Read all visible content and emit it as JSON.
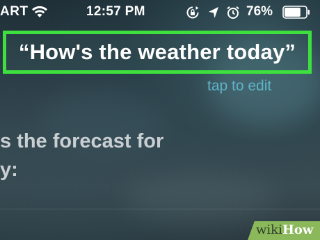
{
  "status_bar": {
    "carrier": "ART",
    "time": "12:57 PM",
    "battery_percent": "76%",
    "battery_level": 0.76,
    "icons": [
      "wifi-icon",
      "rotation-lock-icon",
      "location-icon",
      "alarm-icon",
      "battery-icon"
    ]
  },
  "siri": {
    "query": "“How's the weather today”",
    "tap_to_edit": "tap to edit",
    "response_line_1": "s the forecast for",
    "response_line_2": "y:"
  },
  "watermark": {
    "part1": "wiki",
    "part2": "How"
  },
  "colors": {
    "highlight": "#3ee03e",
    "tap_to_edit": "#5fb3c9",
    "watermark_bg": "#8ab85a"
  }
}
